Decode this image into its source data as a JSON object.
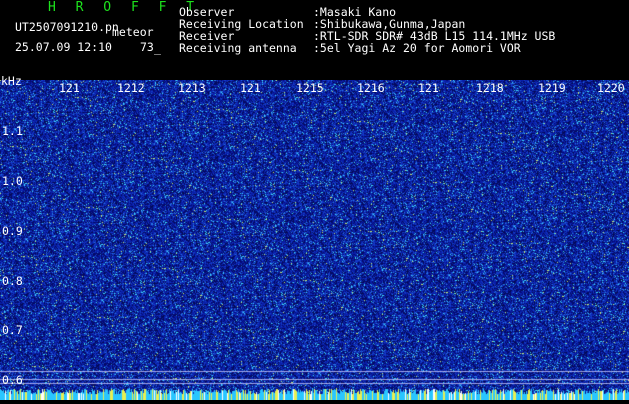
{
  "header": {
    "app_title": "H R O F F T",
    "filename": "UT2507091210.pn",
    "event_label": "meteor",
    "date": "25.07.09 12:10",
    "count_value": "73",
    "count_suffix": "_",
    "observer_label": "Observer",
    "observer_value": ":Masaki Kano",
    "location_label": "Receiving Location",
    "location_value": ":Shibukawa,Gunma,Japan",
    "receiver_label": "Receiver",
    "receiver_value": ":RTL-SDR SDR# 43dB L15 114.1MHz USB",
    "antenna_label": "Receiving antenna",
    "antenna_value": ":5el Yagi Az 20 for Aomori VOR"
  },
  "axes": {
    "y_unit": "kHz",
    "x_ticks": [
      "121",
      "1212",
      "1213",
      "121",
      "1215",
      "1216",
      "121",
      "1218",
      "1219",
      "1220"
    ],
    "y_ticks": [
      "1.1",
      "1.0",
      "0.9",
      "0.8",
      "0.7",
      "0.6"
    ]
  },
  "colors": {
    "background": "#0a1fa8",
    "noise_cyan": "#3fe0ff",
    "noise_yellow": "#e8f050",
    "title_green": "#1de21d",
    "bottom_band": "#29c6ff"
  }
}
